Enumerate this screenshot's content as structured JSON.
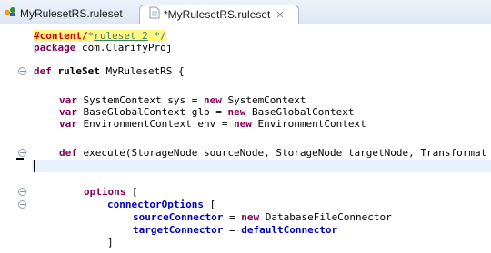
{
  "tabs": [
    {
      "label": "MyRulesetRS.ruleset",
      "active": false,
      "icon": "ruleset-file-icon"
    },
    {
      "label": "*MyRulesetRS.ruleset",
      "active": true,
      "icon": "text-file-icon",
      "close": "✕"
    }
  ],
  "code": {
    "line1_highlight": "#content/",
    "line1_comment_start": "*",
    "line1_comment_underlined": "ruleset 2",
    "line1_comment_end": " */",
    "line2_kw": "package",
    "line2_rest": " com.ClarifyProj",
    "line3_kw": "def",
    "line3_rest_bold": " ruleSet",
    "line3_rest": " MyRulesetRS {",
    "line4_kw": "var",
    "line4_a": " SystemContext sys = ",
    "line4_kw2": "new",
    "line4_b": " SystemContext",
    "line5_kw": "var",
    "line5_a": " BaseGlobalContext glb = ",
    "line5_kw2": "new",
    "line5_b": " BaseGlobalContext",
    "line6_kw": "var",
    "line6_a": " EnvironmentContext env = ",
    "line6_kw2": "new",
    "line6_b": " EnvironmentContext",
    "line7_kw": "def",
    "line7_rest": " execute(StorageNode sourceNode, StorageNode targetNode, Transformat",
    "line8_kw": "options",
    "line8_rest": " [",
    "line9_fld": "connectorOptions",
    "line9_rest": " [",
    "line10_fld": "sourceConnector",
    "line10_a": " = ",
    "line10_kw": "new",
    "line10_b": " DatabaseFileConnector",
    "line11_fld": "targetConnector",
    "line11_a": " = ",
    "line11_fld2": "defaultConnector",
    "line12": "]"
  },
  "colors": {
    "keyword": "#7f0055",
    "field": "#0000c0",
    "comment": "#3f7f5f",
    "highlight": "#fff785",
    "current_line": "#e8f2fe"
  }
}
